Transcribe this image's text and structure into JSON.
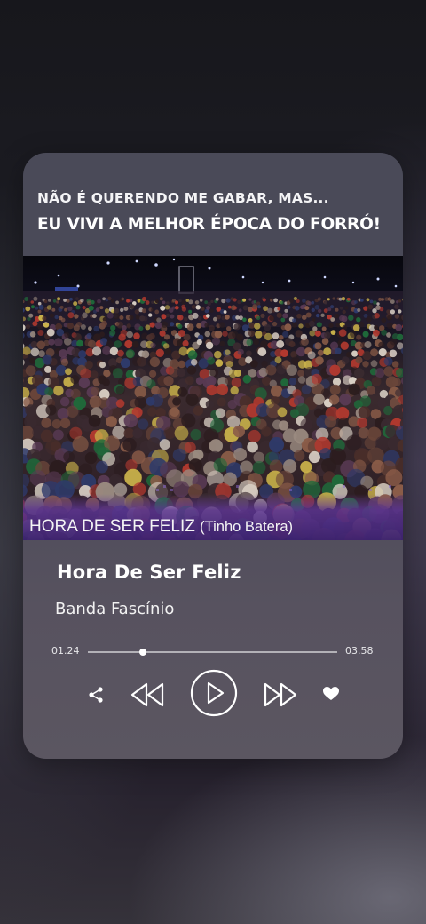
{
  "overlay": {
    "line1": "NÃO É QUERENDO ME GABAR, MAS...",
    "line2": "EU VIVI A MELHOR ÉPOCA DO FORRÓ!"
  },
  "video": {
    "caption_title": "HORA DE SER FELIZ",
    "caption_artist": "(Tinho Batera)"
  },
  "track": {
    "title": "Hora De Ser Feliz",
    "artist": "Banda Fascínio"
  },
  "player": {
    "current_time": "01.24",
    "total_time": "03.58",
    "progress": 0.22
  },
  "controls": {
    "share_icon": "share-icon",
    "previous_icon": "rewind-icon",
    "play_icon": "play-icon",
    "next_icon": "fast-forward-icon",
    "like_icon": "heart-icon"
  },
  "colors": {
    "card_bg": "#4b4a59",
    "caption_band": "#4a2f7a",
    "text": "#ffffff"
  }
}
